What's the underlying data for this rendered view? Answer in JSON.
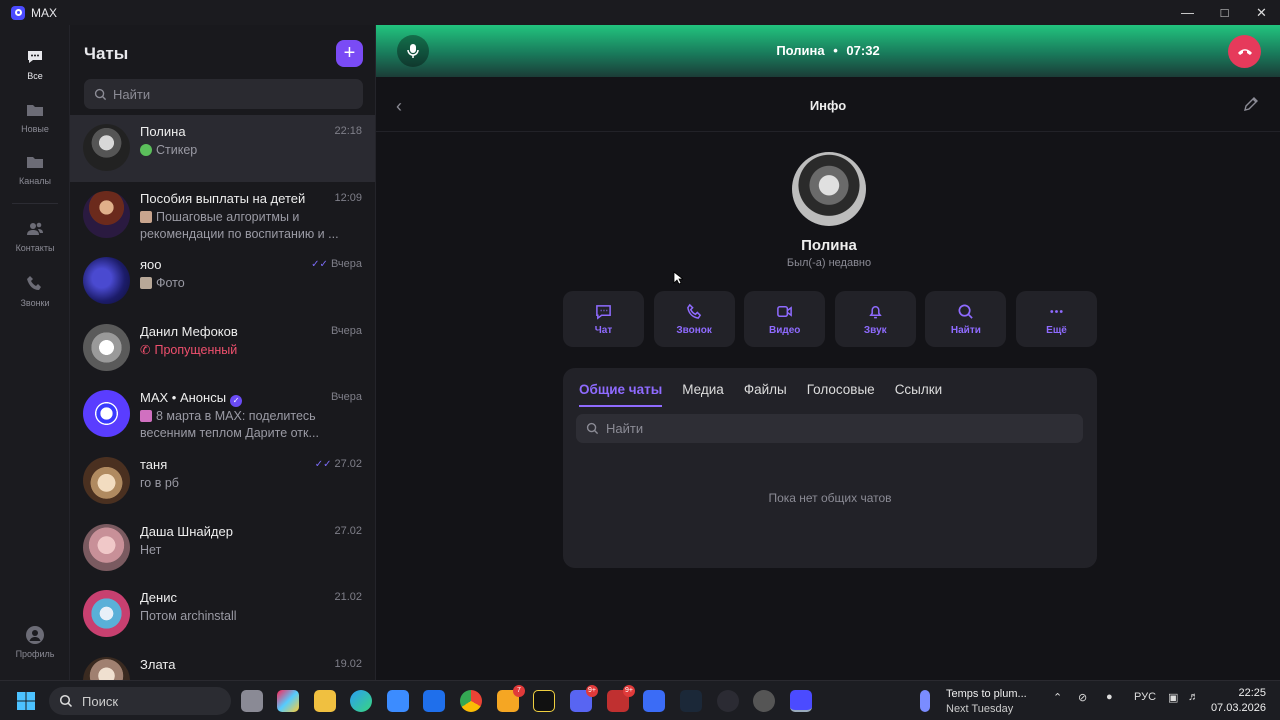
{
  "window": {
    "title": "MAX"
  },
  "rail": {
    "items": [
      {
        "label": "Все",
        "icon": "chat-bubble-icon"
      },
      {
        "label": "Новые",
        "icon": "folder-icon"
      },
      {
        "label": "Каналы",
        "icon": "folder-icon"
      },
      {
        "label": "Контакты",
        "icon": "contacts-icon"
      },
      {
        "label": "Звонки",
        "icon": "phone-icon"
      }
    ],
    "profile_label": "Профиль"
  },
  "chats": {
    "header": "Чаты",
    "add_icon": "plus-icon",
    "search_placeholder": "Найти",
    "list": [
      {
        "name": "Полина",
        "time": "22:18",
        "message": "Стикер",
        "active": true
      },
      {
        "name": "Пособия выплаты на детей",
        "time": "12:09",
        "message": "Пошаговые алгоритмы и рекомендации по воспитанию и ..."
      },
      {
        "name": "яоо",
        "time": "Вчера",
        "message": "Фото",
        "read": true
      },
      {
        "name": "Данил Мефоков",
        "time": "Вчера",
        "message": "Пропущенный",
        "missed": true
      },
      {
        "name": "MAX • Анонсы",
        "time": "Вчера",
        "message": "8 марта в MAX: поделитесь весенним теплом  Дарите отк...",
        "verified": true
      },
      {
        "name": "таня",
        "time": "27.02",
        "message": "го в рб",
        "read": true
      },
      {
        "name": "Даша Шнайдер",
        "time": "27.02",
        "message": "Нет"
      },
      {
        "name": "Денис",
        "time": "21.02",
        "message": "Потом archinstall"
      },
      {
        "name": "Злата",
        "time": "19.02",
        "message": ""
      }
    ]
  },
  "call": {
    "name": "Полина",
    "separator": "•",
    "duration": "07:32"
  },
  "info": {
    "title": "Инфо",
    "name": "Полина",
    "status": "Был(-а) недавно",
    "actions": [
      {
        "label": "Чат",
        "icon": "chat-icon"
      },
      {
        "label": "Звонок",
        "icon": "phone-icon"
      },
      {
        "label": "Видео",
        "icon": "video-icon"
      },
      {
        "label": "Звук",
        "icon": "bell-icon"
      },
      {
        "label": "Найти",
        "icon": "search-icon"
      },
      {
        "label": "Ещё",
        "icon": "more-icon"
      }
    ],
    "tabs": [
      "Общие чаты",
      "Медиа",
      "Файлы",
      "Голосовые",
      "Ссылки"
    ],
    "active_tab": "Общие чаты",
    "search_placeholder": "Найти",
    "empty_text": "Пока нет общих чатов"
  },
  "taskbar": {
    "search_placeholder": "Поиск",
    "weather_title": "Temps to plum...",
    "weather_subtitle": "Next Tuesday",
    "language": "РУС",
    "time": "22:25",
    "date": "07.03.2026",
    "badges": {
      "app1": "7",
      "discord": "9+",
      "app2": "9+"
    }
  },
  "colors": {
    "accent": "#7a4bf5",
    "call_green": "#22c47e",
    "hangup": "#e63a5b",
    "missed": "#f0506e"
  }
}
